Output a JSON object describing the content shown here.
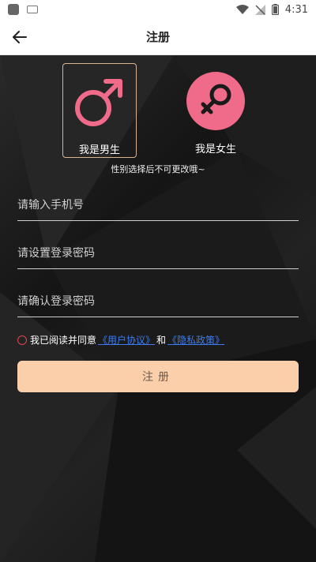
{
  "status_bar": {
    "time": "4:31"
  },
  "app_bar": {
    "title": "注册"
  },
  "gender": {
    "male_label": "我是男生",
    "female_label": "我是女生",
    "hint": "性别选择后不可更改哦~",
    "selected": "male",
    "male_color": "#f06a8a",
    "female_color": "#f06a8a"
  },
  "form": {
    "phone_placeholder": "请输入手机号",
    "password_placeholder": "请设置登录密码",
    "confirm_placeholder": "请确认登录密码"
  },
  "agreement": {
    "prefix": "我已阅读并同意",
    "user_agreement": "《用户协议》",
    "and": "和",
    "privacy_policy": "《隐私政策》"
  },
  "register_button": {
    "label": "注册"
  },
  "colors": {
    "accent": "#fbcfaa",
    "link": "#3c7cf0",
    "radio": "#e0454d"
  }
}
